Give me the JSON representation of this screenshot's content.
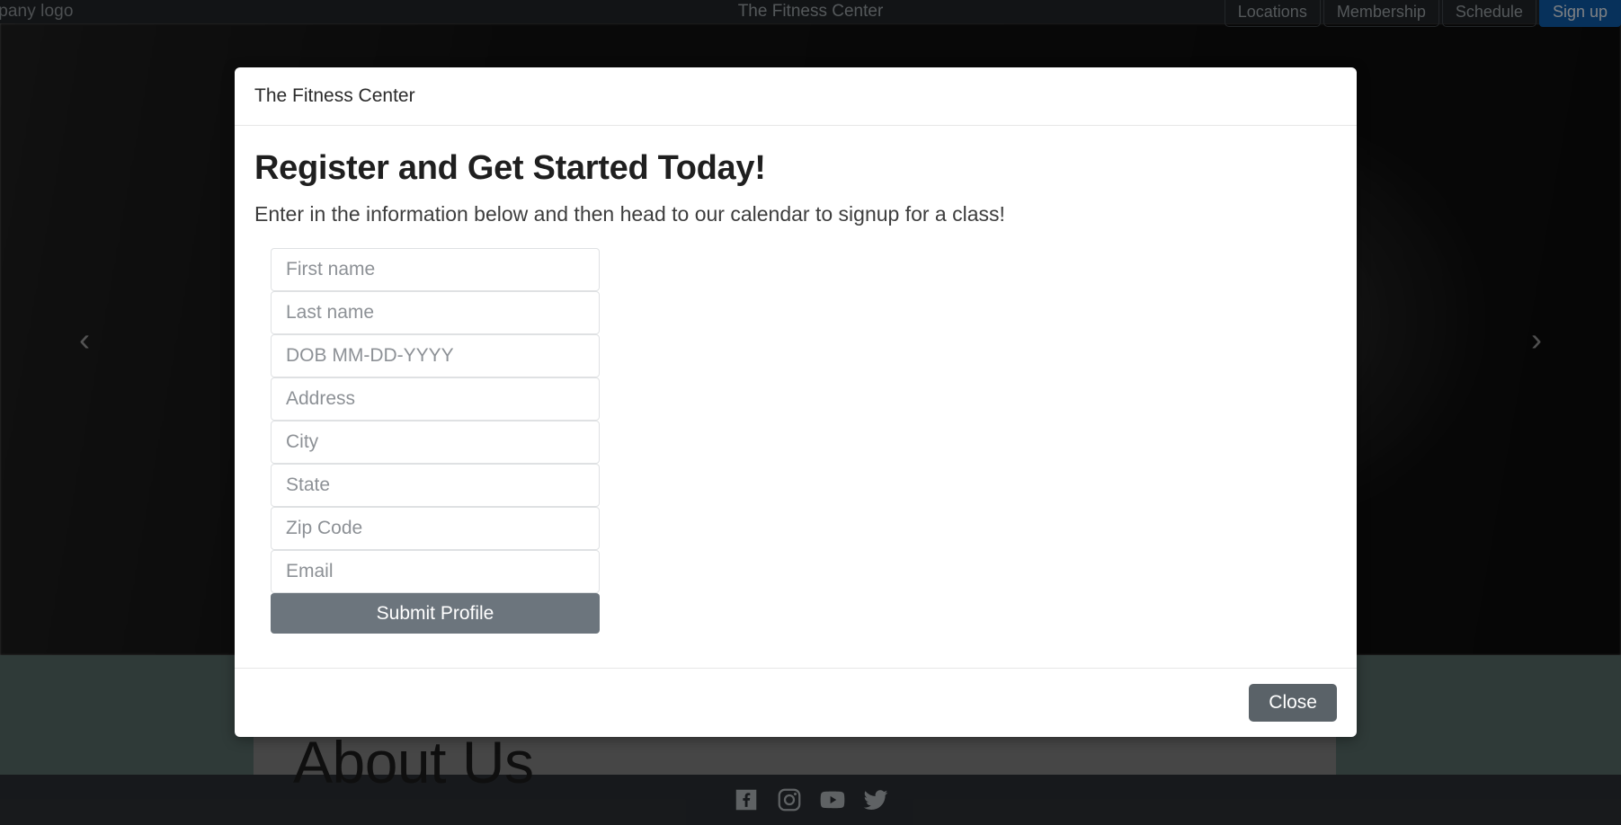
{
  "navbar": {
    "brand": "company logo",
    "title": "The Fitness Center",
    "links": [
      {
        "label": "Locations",
        "name": "nav-link-locations",
        "primary": false
      },
      {
        "label": "Membership",
        "name": "nav-link-membership",
        "primary": false
      },
      {
        "label": "Schedule",
        "name": "nav-link-schedule",
        "primary": false
      },
      {
        "label": "Sign up",
        "name": "nav-link-signup",
        "primary": true
      }
    ]
  },
  "hero": {
    "prev_arrow": "‹",
    "next_arrow": "›"
  },
  "section": {
    "about_heading": "About Us"
  },
  "footer": {
    "social": [
      {
        "name": "facebook-icon",
        "label": "Facebook"
      },
      {
        "name": "instagram-icon",
        "label": "Instagram"
      },
      {
        "name": "youtube-icon",
        "label": "YouTube"
      },
      {
        "name": "twitter-icon",
        "label": "Twitter"
      }
    ]
  },
  "modal": {
    "title": "The Fitness Center",
    "heading": "Register and Get Started Today!",
    "subheading": "Enter in the information below and then head to our calendar to signup for a class!",
    "fields": [
      {
        "name": "first-name-input",
        "placeholder": "First name",
        "value": ""
      },
      {
        "name": "last-name-input",
        "placeholder": "Last name",
        "value": ""
      },
      {
        "name": "dob-input",
        "placeholder": "DOB MM-DD-YYYY",
        "value": ""
      },
      {
        "name": "address-input",
        "placeholder": "Address",
        "value": ""
      },
      {
        "name": "city-input",
        "placeholder": "City",
        "value": ""
      },
      {
        "name": "state-input",
        "placeholder": "State",
        "value": ""
      },
      {
        "name": "zip-code-input",
        "placeholder": "Zip Code",
        "value": ""
      },
      {
        "name": "email-input",
        "placeholder": "Email",
        "value": ""
      }
    ],
    "submit_label": "Submit Profile",
    "close_label": "Close"
  },
  "colors": {
    "navbar_bg": "#212529",
    "signup_blue": "#0d5aa7",
    "submit_gray": "#6c757d",
    "close_gray": "#5a6268",
    "section_band": "#566a66",
    "footer_bg": "#2b2f33"
  }
}
